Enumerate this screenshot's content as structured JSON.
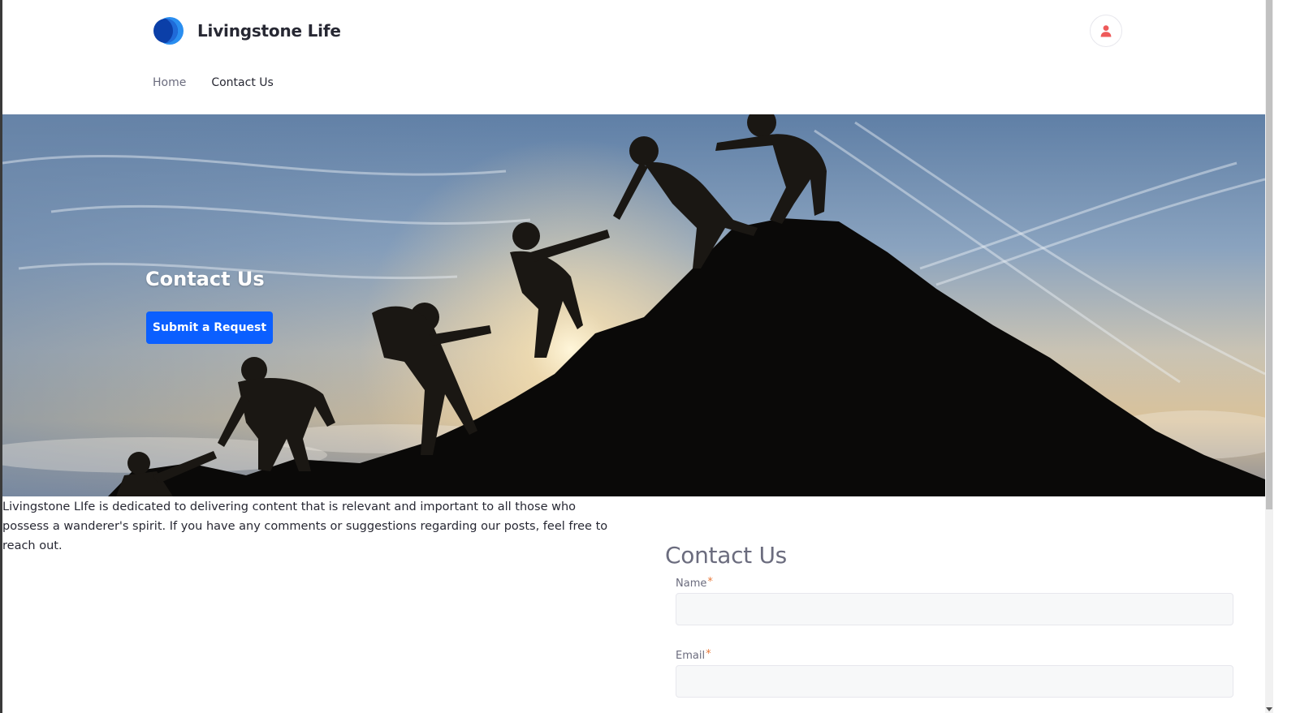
{
  "site": {
    "name": "Livingstone Life"
  },
  "header": {
    "user_icon": "user-icon"
  },
  "nav": {
    "items": [
      {
        "label": "Home",
        "active": false
      },
      {
        "label": "Contact Us",
        "active": true
      }
    ]
  },
  "hero": {
    "title": "Contact Us",
    "button_label": "Submit a Request"
  },
  "intro": {
    "text": "Livingstone LIfe is dedicated to delivering content that is relevant and important to all those who possess a wanderer's spirit.  If you have any comments or suggestions regarding our posts, feel free to reach out."
  },
  "form": {
    "title": "Contact Us",
    "fields": [
      {
        "label": "Name",
        "required_mark": "*",
        "value": ""
      },
      {
        "label": "Email",
        "required_mark": "*",
        "value": ""
      }
    ]
  },
  "colors": {
    "primary": "#0b5fff",
    "logo_dark": "#0b3fa8",
    "logo_light": "#2a8ef0",
    "user_icon": "#ee5a5a",
    "required": "#e97a3b"
  }
}
